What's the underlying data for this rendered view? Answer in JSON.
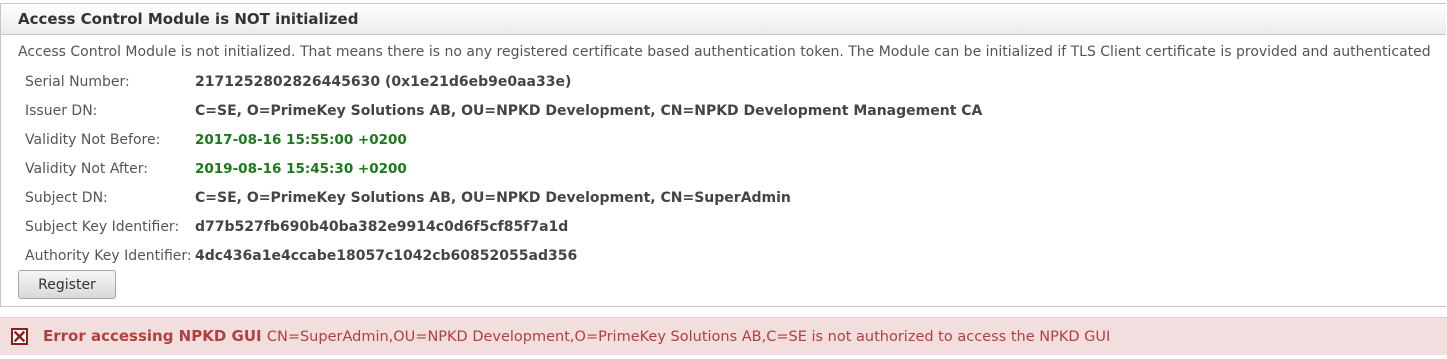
{
  "panel": {
    "title": "Access Control Module is NOT initialized",
    "intro": "Access Control Module is not initialized. That means there is no any registered certificate based authentication token. The Module can be initialized if TLS Client certificate is provided and authenticated"
  },
  "certificate": [
    {
      "label": "Serial Number:",
      "value": "2171252802826445630 (0x1e21d6eb9e0aa33e)"
    },
    {
      "label": "Issuer DN:",
      "value": "C=SE, O=PrimeKey Solutions AB, OU=NPKD Development, CN=NPKD Development Management CA"
    },
    {
      "label": "Validity Not Before:",
      "value": "2017-08-16 15:55:00 +0200"
    },
    {
      "label": "Validity Not After:",
      "value": "2019-08-16 15:45:30 +0200"
    },
    {
      "label": "Subject DN:",
      "value": "C=SE, O=PrimeKey Solutions AB, OU=NPKD Development, CN=SuperAdmin"
    },
    {
      "label": "Subject Key Identifier:",
      "value": "d77b527fb690b40ba382e9914c0d6f5cf85f7a1d"
    },
    {
      "label": "Authority Key Identifier:",
      "value": "4dc436a1e4ccabe18057c1042cb60852055ad356"
    }
  ],
  "actions": {
    "register_label": "Register"
  },
  "error": {
    "title": "Error accessing NPKD GUI",
    "detail": "CN=SuperAdmin,OU=NPKD Development,O=PrimeKey Solutions AB,C=SE is not authorized to access the NPKD GUI"
  },
  "colors": {
    "validity_date": "#1a7a1a",
    "error_background": "#f2dede",
    "error_text": "#b0413e"
  },
  "icons": {
    "error": "close-box-icon"
  }
}
